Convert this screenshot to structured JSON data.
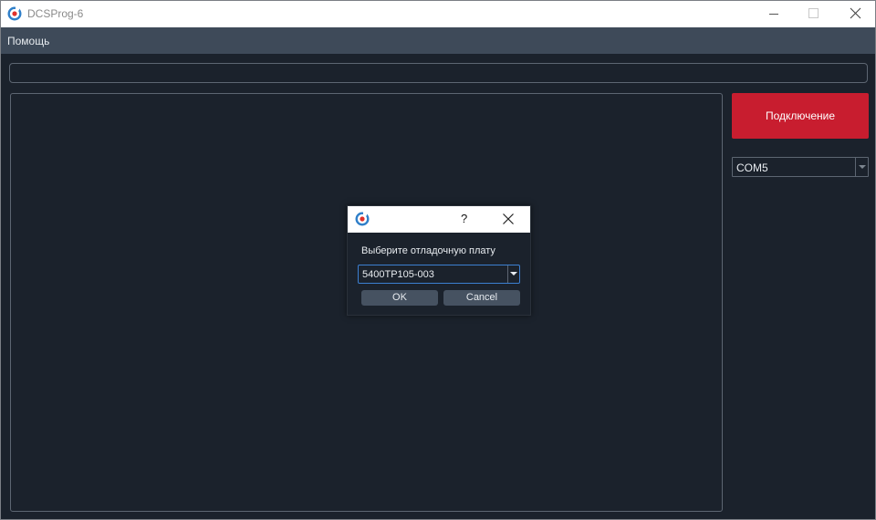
{
  "window": {
    "title": "DCSProg-6",
    "icons": {
      "app": "app-logo-icon",
      "minimize": "minimize-icon",
      "maximize": "maximize-icon",
      "close": "close-icon"
    }
  },
  "menu": {
    "items": [
      {
        "label": "Помощь"
      }
    ]
  },
  "top_input": {
    "value": ""
  },
  "sidebar": {
    "connect_label": "Подключение",
    "port_select": {
      "value": "COM5"
    }
  },
  "dialog": {
    "help_label": "?",
    "prompt": "Выберите отладочную плату",
    "board_select": {
      "value": "5400TP105-003"
    },
    "ok_label": "OK",
    "cancel_label": "Cancel"
  },
  "colors": {
    "background": "#1b222c",
    "menubar": "#3e4a59",
    "connect_button": "#c81d2f",
    "focus_border": "#3c7fd1",
    "logo_blue": "#2f7fc9",
    "logo_red": "#e0302a"
  }
}
